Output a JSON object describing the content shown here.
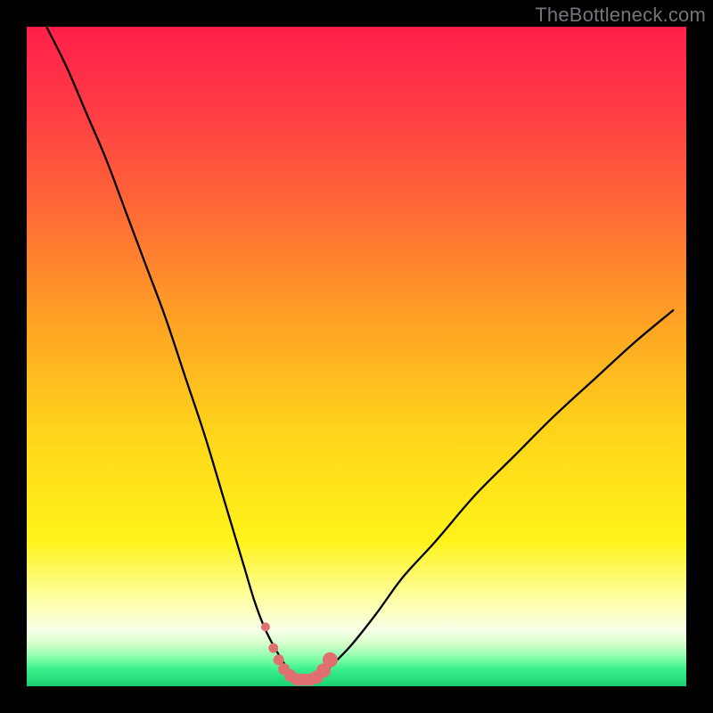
{
  "watermark": "TheBottleneck.com",
  "colors": {
    "background": "#000000",
    "curve_stroke": "#000000",
    "marker_fill": "#e07070",
    "gradient_stops": [
      {
        "offset": 0.0,
        "color": "#ff1f4a"
      },
      {
        "offset": 0.12,
        "color": "#ff3a45"
      },
      {
        "offset": 0.28,
        "color": "#ff6a36"
      },
      {
        "offset": 0.45,
        "color": "#ffa324"
      },
      {
        "offset": 0.62,
        "color": "#ffd61a"
      },
      {
        "offset": 0.78,
        "color": "#fff31a"
      },
      {
        "offset": 0.87,
        "color": "#fdffa8"
      },
      {
        "offset": 0.915,
        "color": "#f8ffe8"
      },
      {
        "offset": 0.935,
        "color": "#d6ffcc"
      },
      {
        "offset": 0.955,
        "color": "#8dffac"
      },
      {
        "offset": 0.975,
        "color": "#38f08a"
      },
      {
        "offset": 1.0,
        "color": "#18d070"
      }
    ]
  },
  "chart_data": {
    "type": "line",
    "title": "",
    "xlabel": "",
    "ylabel": "",
    "xlim": [
      0,
      100
    ],
    "ylim": [
      0,
      100
    ],
    "grid": false,
    "legend": false,
    "series": [
      {
        "name": "bottleneck-curve",
        "x": [
          3,
          6,
          9,
          12,
          15,
          18,
          21,
          24,
          27,
          30,
          31.5,
          33,
          34.5,
          36,
          37.5,
          39,
          40,
          41,
          42,
          43,
          44,
          45,
          49,
          53,
          57,
          62,
          68,
          74,
          80,
          86,
          92,
          98
        ],
        "y": [
          100,
          94,
          87,
          80,
          72,
          64,
          56,
          47,
          38,
          28,
          23,
          18,
          13,
          9,
          6,
          3.5,
          2,
          1.2,
          1,
          1,
          1.2,
          2,
          6,
          11,
          16.5,
          22,
          29,
          35,
          41,
          46.5,
          52,
          57
        ]
      }
    ],
    "markers": {
      "name": "valley-markers",
      "x": [
        36.2,
        37.4,
        38.2,
        39.0,
        40.0,
        41.0,
        42.0,
        43.0,
        44.0,
        45.0,
        46.0
      ],
      "y": [
        9.0,
        5.8,
        4.0,
        2.6,
        1.6,
        1.0,
        1.0,
        1.0,
        1.4,
        2.4,
        4.0
      ],
      "r": [
        5,
        5.5,
        6,
        6.5,
        7,
        7,
        7,
        7,
        7.5,
        8,
        8.5
      ]
    }
  }
}
